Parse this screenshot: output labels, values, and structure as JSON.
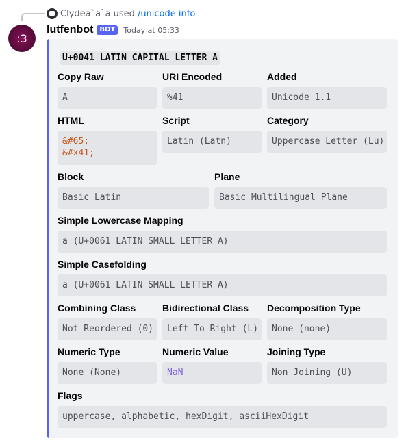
{
  "reply": {
    "user": "Clydea`a`a used",
    "command": "/unicode info"
  },
  "avatar": {
    "text": ":3"
  },
  "message": {
    "author": "lutfenbot",
    "badge": "BOT",
    "timestamp": "Today at 05:33"
  },
  "embed": {
    "accent_color": "#5865f2",
    "title": "U+0041 LATIN CAPITAL LETTER A",
    "fields": {
      "copy_raw": {
        "name": "Copy Raw",
        "value": "A"
      },
      "uri_encoded": {
        "name": "URI Encoded",
        "value": "%41"
      },
      "added": {
        "name": "Added",
        "value": "Unicode 1.1"
      },
      "html": {
        "name": "HTML",
        "line1": "&#65;",
        "line2": "&#x41;"
      },
      "script": {
        "name": "Script",
        "value": "Latin (Latn)"
      },
      "category": {
        "name": "Category",
        "value": "Uppercase Letter (Lu)"
      },
      "block": {
        "name": "Block",
        "value": "Basic Latin"
      },
      "plane": {
        "name": "Plane",
        "value": "Basic Multilingual Plane"
      },
      "lowercase": {
        "name": "Simple Lowercase Mapping",
        "value": "a (U+0061 LATIN SMALL LETTER A)"
      },
      "casefolding": {
        "name": "Simple Casefolding",
        "value": "a (U+0061 LATIN SMALL LETTER A)"
      },
      "combining": {
        "name": "Combining Class",
        "value": "Not Reordered (0)"
      },
      "bidi": {
        "name": "Bidirectional Class",
        "value": "Left To Right (L)"
      },
      "decomposition": {
        "name": "Decomposition Type",
        "value": "None (none)"
      },
      "numeric_type": {
        "name": "Numeric Type",
        "value": "None (None)"
      },
      "numeric_value": {
        "name": "Numeric Value",
        "value": "NaN"
      },
      "joining": {
        "name": "Joining Type",
        "value": "Non Joining (U)"
      },
      "flags": {
        "name": "Flags",
        "value": "uppercase, alphabetic, hexDigit, asciiHexDigit"
      }
    }
  }
}
